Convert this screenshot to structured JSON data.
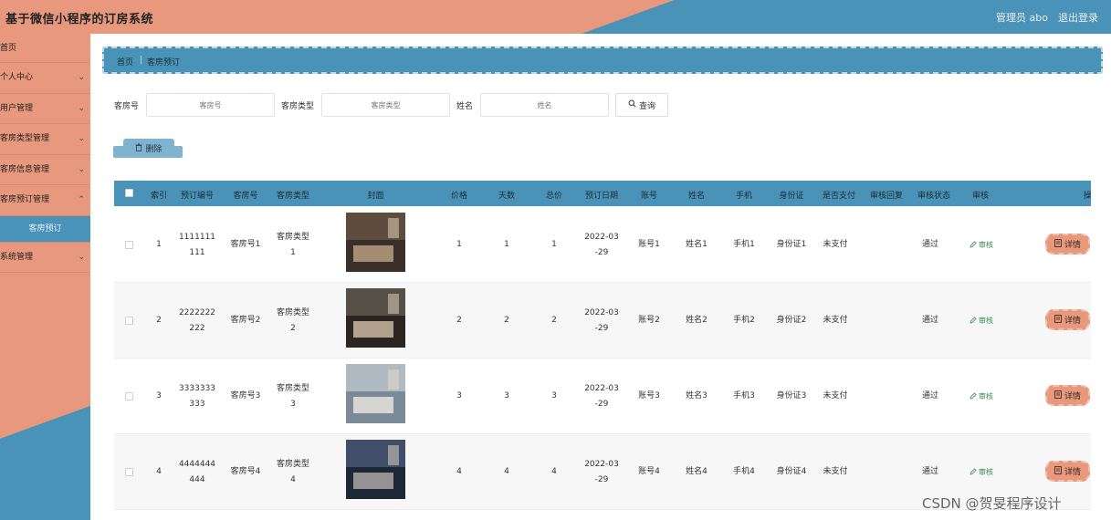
{
  "header": {
    "title": "基于微信小程序的订房系统",
    "user": "管理员 abo",
    "logout": "退出登录"
  },
  "sidebar": {
    "items": [
      {
        "label": "首页"
      },
      {
        "label": "个人中心"
      },
      {
        "label": "用户管理"
      },
      {
        "label": "客房类型管理"
      },
      {
        "label": "客房信息管理"
      },
      {
        "label": "客房预订管理"
      }
    ],
    "sub_item": "客房预订",
    "last_item": "系统管理"
  },
  "breadcrumb": {
    "home": "首页",
    "current": "客房预订"
  },
  "search": {
    "room_no_label": "客房号",
    "room_no_placeholder": "客房号",
    "room_type_label": "客房类型",
    "room_type_placeholder": "客房类型",
    "name_label": "姓名",
    "name_placeholder": "姓名",
    "query_label": "查询"
  },
  "toolbar": {
    "delete_label": "删除"
  },
  "table": {
    "headers": [
      "索引",
      "预订编号",
      "客房号",
      "客房类型",
      "封面",
      "价格",
      "天数",
      "总价",
      "预订日期",
      "账号",
      "姓名",
      "手机",
      "身份证",
      "是否支付",
      "审核回复",
      "审核状态",
      "审核",
      "操"
    ],
    "rows": [
      {
        "index": "1",
        "order_no_1": "1111111",
        "order_no_2": "111",
        "room_no": "客房号1",
        "room_type_1": "客房类型",
        "room_type_2": "1",
        "price": "1",
        "days": "1",
        "total": "1",
        "date_1": "2022-03",
        "date_2": "-29",
        "account": "账号1",
        "name": "姓名1",
        "phone": "手机1",
        "id_card": "身份证1",
        "paid": "未支付",
        "reply": "",
        "status": "通过",
        "audit": "审核",
        "detail": "详情"
      },
      {
        "index": "2",
        "order_no_1": "2222222",
        "order_no_2": "222",
        "room_no": "客房号2",
        "room_type_1": "客房类型",
        "room_type_2": "2",
        "price": "2",
        "days": "2",
        "total": "2",
        "date_1": "2022-03",
        "date_2": "-29",
        "account": "账号2",
        "name": "姓名2",
        "phone": "手机2",
        "id_card": "身份证2",
        "paid": "未支付",
        "reply": "",
        "status": "通过",
        "audit": "审核",
        "detail": "详情"
      },
      {
        "index": "3",
        "order_no_1": "3333333",
        "order_no_2": "333",
        "room_no": "客房号3",
        "room_type_1": "客房类型",
        "room_type_2": "3",
        "price": "3",
        "days": "3",
        "total": "3",
        "date_1": "2022-03",
        "date_2": "-29",
        "account": "账号3",
        "name": "姓名3",
        "phone": "手机3",
        "id_card": "身份证3",
        "paid": "未支付",
        "reply": "",
        "status": "通过",
        "audit": "审核",
        "detail": "详情"
      },
      {
        "index": "4",
        "order_no_1": "4444444",
        "order_no_2": "444",
        "room_no": "客房号4",
        "room_type_1": "客房类型",
        "room_type_2": "4",
        "price": "4",
        "days": "4",
        "total": "4",
        "date_1": "2022-03",
        "date_2": "-29",
        "account": "账号4",
        "name": "姓名4",
        "phone": "手机4",
        "id_card": "身份证4",
        "paid": "未支付",
        "reply": "",
        "status": "通过",
        "audit": "审核",
        "detail": "详情"
      }
    ]
  },
  "watermark": "CSDN @贺旻程序设计",
  "colors": {
    "salmon": "#e8987c",
    "blue": "#4a93b8",
    "audit_green": "#3a8a4e"
  },
  "icons": [
    "chevron-down-icon",
    "search-icon",
    "trash-icon",
    "edit-icon",
    "detail-icon"
  ]
}
